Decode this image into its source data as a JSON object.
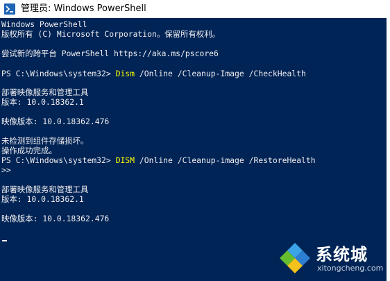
{
  "window": {
    "title": "管理员: Windows PowerShell"
  },
  "console": {
    "lines": [
      "Windows PowerShell",
      "版权所有 (C) Microsoft Corporation。保留所有权利。",
      "",
      "尝试新的跨平台 PowerShell https://aka.ms/pscore6",
      "",
      "",
      "",
      "部署映像服务和管理工具",
      "版本: 10.0.18362.1",
      "",
      "映像版本: 10.0.18362.476",
      "",
      "未检测到组件存储损坏。",
      "操作成功完成。",
      "",
      ">>",
      "",
      "部署映像服务和管理工具",
      "版本: 10.0.18362.1",
      "",
      "映像版本: 10.0.18362.476"
    ],
    "command1": {
      "prompt": "PS C:\\Windows\\system32> ",
      "cmd": "Dism",
      "args": " /Online /Cleanup-Image /CheckHealth"
    },
    "command2": {
      "prompt": "PS C:\\Windows\\system32> ",
      "cmd": "DISM",
      "args": " /Online /Cleanup-image /RestoreHealth"
    }
  },
  "watermark": {
    "name": "系统城",
    "url": "xitongcheng.com"
  },
  "colors": {
    "console_background": "#012456",
    "console_text": "#eeedf0",
    "command_highlight": "#ffff00"
  }
}
